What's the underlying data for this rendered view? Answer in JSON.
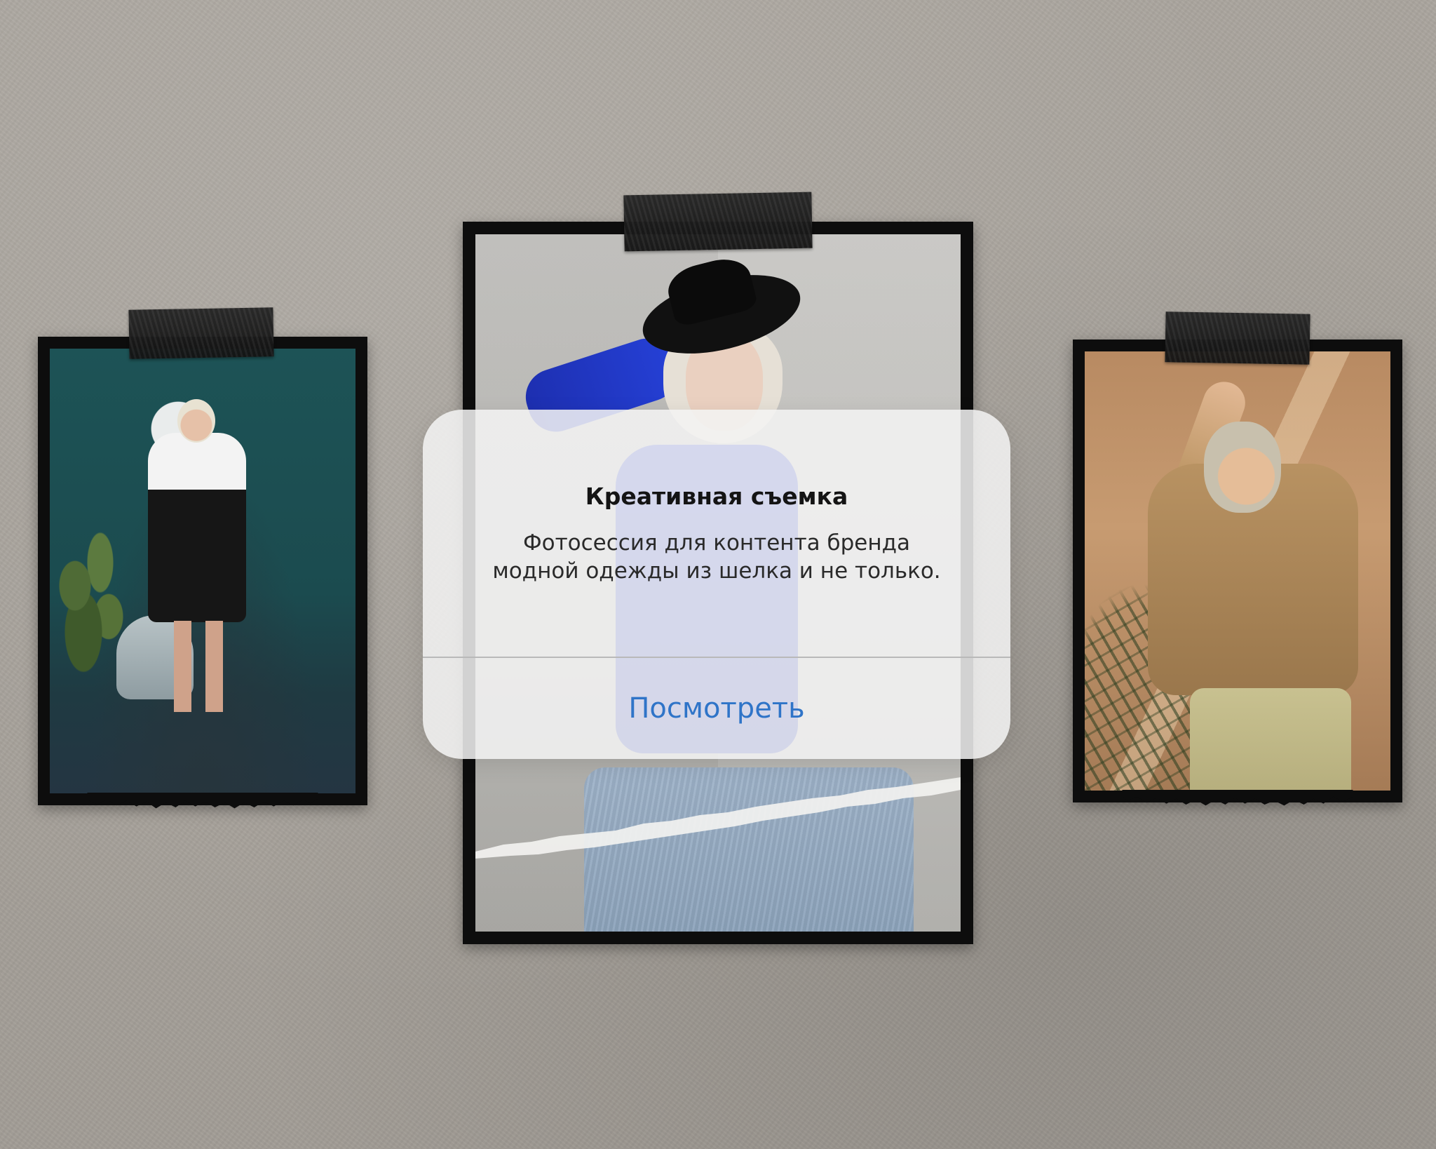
{
  "dialog": {
    "title": "Креативная съемка",
    "message_line1": "Фотосессия для контента бренда",
    "message_line2": "модной одежды из шелка и не только.",
    "action_label": "Посмотреть"
  },
  "colors": {
    "wall": "#a9a49d",
    "frame": "#0d0d0d",
    "tape": "#1e1e1e",
    "dialog_background": "#f3f3f3",
    "title_text": "#141414",
    "action_text": "#2f74c8"
  },
  "photos": [
    {
      "name": "teal-room-photo"
    },
    {
      "name": "grey-wall-photo"
    },
    {
      "name": "warm-light-photo"
    }
  ]
}
